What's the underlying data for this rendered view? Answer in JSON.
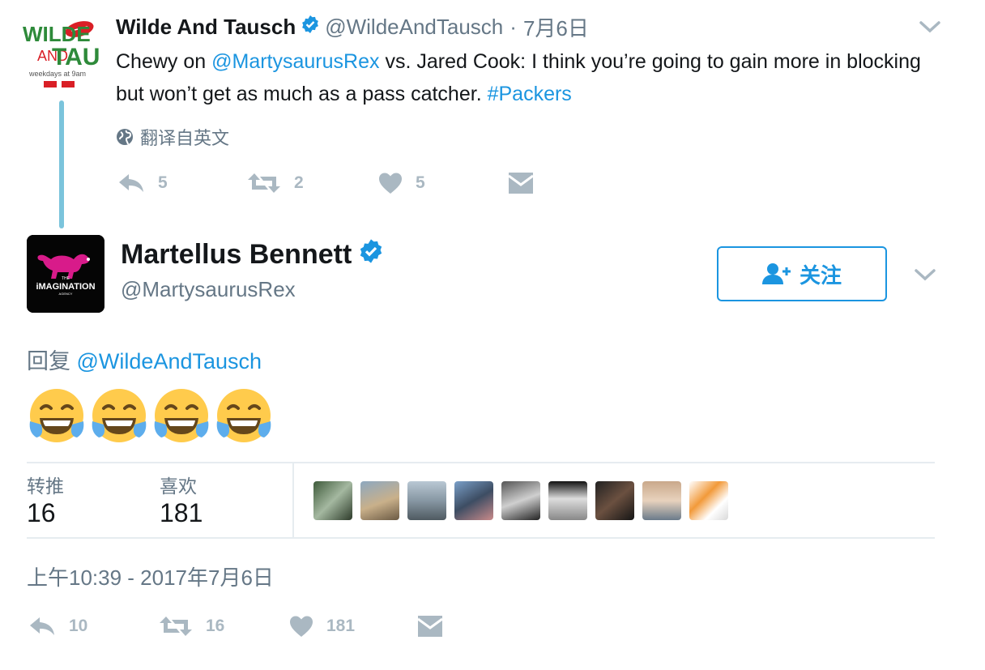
{
  "parent_tweet": {
    "avatar_lines": [
      "WILDE",
      "AND",
      "TAUSCH",
      "weekdays at 9am"
    ],
    "name": "Wilde And Tausch",
    "handle": "@WildeAndTausch",
    "separator": "·",
    "date": "7月6日",
    "text_before_mention": "Chewy on ",
    "mention": "@MartysaurusRex",
    "text_after_mention": " vs. Jared Cook: I think you’re going to gain more in blocking but won’t get as much as a pass catcher. ",
    "hashtag": "#Packers",
    "translate_label": "翻译自英文",
    "actions": {
      "reply_count": "5",
      "retweet_count": "2",
      "like_count": "5"
    }
  },
  "main_tweet": {
    "avatar_lines": [
      "THE",
      "iMAGINATION",
      "AGENCY"
    ],
    "name": "Martellus Bennett",
    "handle": "@MartysaurusRex",
    "follow_label": "关注",
    "reply_prefix": "回复 ",
    "reply_to": "@WildeAndTausch",
    "emoji_count": 4,
    "stats": {
      "retweets_label": "转推",
      "retweets_value": "16",
      "likes_label": "喜欢",
      "likes_value": "181"
    },
    "timestamp": "上午10:39 - 2017年7月6日",
    "actions": {
      "reply_count": "10",
      "retweet_count": "16",
      "like_count": "181"
    }
  },
  "colors": {
    "link": "#1b95e0",
    "muted": "#657786",
    "action_gray": "#aab8c2",
    "thread_line": "#7bc4dc",
    "divider": "#e6ecf0"
  }
}
